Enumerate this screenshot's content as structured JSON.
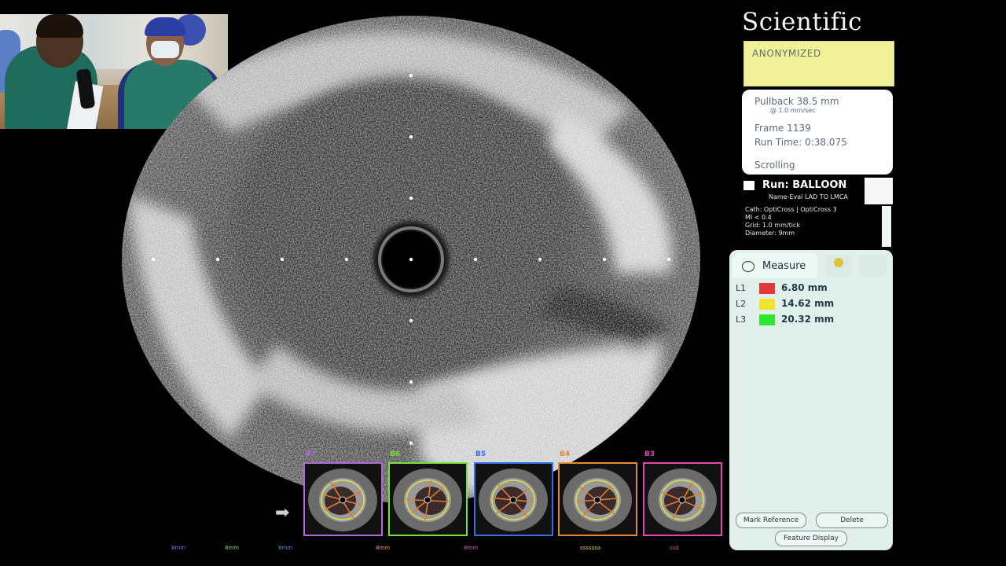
{
  "brand": {
    "text": "Scientific"
  },
  "patient": {
    "label": "ANONYMIZED"
  },
  "info": {
    "pullback": "Pullback 38.5 mm",
    "speed": "@ 1.0 mm/sec",
    "frame": "Frame 1139",
    "run_time": "Run Time: 0:38.075",
    "mode": "Scrolling"
  },
  "run": {
    "title": "Run: BALLOON",
    "name": "Name-Eval LAD TO LMCA",
    "cath": "Cath: OptiCross | OptiCross 3",
    "mi": "MI < 0.4",
    "grid": "Grid: 1.0 mm/tick",
    "diameter": "Diameter: 9mm"
  },
  "measure": {
    "tab_label": "Measure",
    "rows": [
      {
        "id": "L1",
        "value": "6.80 mm",
        "color": "#e23a3a"
      },
      {
        "id": "L2",
        "value": "14.62 mm",
        "color": "#f0e22e"
      },
      {
        "id": "L3",
        "value": "20.32 mm",
        "color": "#2fe52f"
      }
    ],
    "mark_reference": "Mark Reference",
    "delete": "Delete",
    "feature_display": "Feature Display"
  },
  "thumbnails": [
    {
      "label": "B7",
      "color": "#b06ad6",
      "ring": "#d9e24b",
      "lines": "#e27a2e"
    },
    {
      "label": "B6",
      "color": "#78e03a",
      "ring": "#d9e24b",
      "lines": "#e27a2e"
    },
    {
      "label": "B5",
      "color": "#3a6ee0",
      "ring": "#d9e24b",
      "lines": "#e27a2e"
    },
    {
      "label": "B4",
      "color": "#e08a3a",
      "ring": "#d9e24b",
      "lines": "#e27a2e"
    },
    {
      "label": "B3",
      "color": "#e04ab0",
      "ring": "#d9e24b",
      "lines": "#e27a2e"
    }
  ],
  "bottom_labels": [
    {
      "text": "8mm",
      "color": "#9a6ae0"
    },
    {
      "text": "8mm",
      "color": "#6ae05a"
    },
    {
      "text": "8mm",
      "color": "#5a8ae0"
    },
    {
      "text": "8mm",
      "color": "#e0a05a"
    },
    {
      "text": "8mm",
      "color": "#e05ab0"
    },
    {
      "text": "ssssssa",
      "color": "#e0d05a"
    },
    {
      "text": "ssd",
      "color": "#e05a5a"
    }
  ],
  "ultrasound": {
    "grid_ticks": 8
  }
}
